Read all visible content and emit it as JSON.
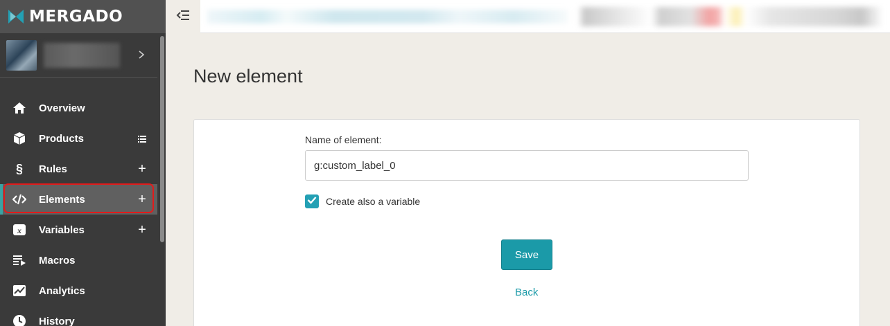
{
  "app": {
    "logo_text": "MERGADO",
    "brand_color": "#23a0b4"
  },
  "sidebar": {
    "items": [
      {
        "label": "Overview",
        "icon": "home-icon",
        "action": ""
      },
      {
        "label": "Products",
        "icon": "box-icon",
        "action": "list-icon"
      },
      {
        "label": "Rules",
        "icon": "section-icon",
        "action": "+"
      },
      {
        "label": "Elements",
        "icon": "code-icon",
        "action": "+",
        "active": true
      },
      {
        "label": "Variables",
        "icon": "variable-icon",
        "action": "+"
      },
      {
        "label": "Macros",
        "icon": "macros-icon",
        "action": ""
      },
      {
        "label": "Analytics",
        "icon": "chart-icon",
        "action": ""
      },
      {
        "label": "History",
        "icon": "clock-icon",
        "action": ""
      }
    ],
    "highlight_color": "#e21b1b"
  },
  "main": {
    "title": "New element",
    "form": {
      "name_label": "Name of element:",
      "name_value": "g:custom_label_0",
      "create_variable_label": "Create also a variable",
      "create_variable_checked": true,
      "save_label": "Save",
      "back_label": "Back"
    }
  }
}
